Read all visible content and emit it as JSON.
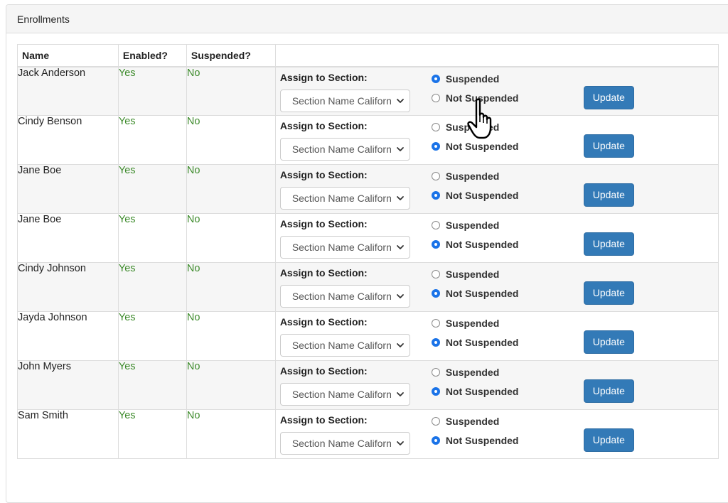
{
  "panel": {
    "title": "Enrollments"
  },
  "table": {
    "headers": {
      "name": "Name",
      "enabled": "Enabled?",
      "suspended": "Suspended?",
      "actions": ""
    },
    "rows": [
      {
        "name": "Jack Anderson",
        "enabled": "Yes",
        "suspended": "No",
        "assign_label": "Assign to Section:",
        "section_value": "Section Name Californ",
        "opt_suspended": "Suspended",
        "opt_not_suspended": "Not Suspended",
        "selected": "suspended",
        "button": "Update"
      },
      {
        "name": "Cindy Benson",
        "enabled": "Yes",
        "suspended": "No",
        "assign_label": "Assign to Section:",
        "section_value": "Section Name Californ",
        "opt_suspended": "Suspended",
        "opt_not_suspended": "Not Suspended",
        "selected": "not_suspended",
        "button": "Update"
      },
      {
        "name": "Jane Boe",
        "enabled": "Yes",
        "suspended": "No",
        "assign_label": "Assign to Section:",
        "section_value": "Section Name Californ",
        "opt_suspended": "Suspended",
        "opt_not_suspended": "Not Suspended",
        "selected": "not_suspended",
        "button": "Update"
      },
      {
        "name": "Jane Boe",
        "enabled": "Yes",
        "suspended": "No",
        "assign_label": "Assign to Section:",
        "section_value": "Section Name Californ",
        "opt_suspended": "Suspended",
        "opt_not_suspended": "Not Suspended",
        "selected": "not_suspended",
        "button": "Update"
      },
      {
        "name": "Cindy Johnson",
        "enabled": "Yes",
        "suspended": "No",
        "assign_label": "Assign to Section:",
        "section_value": "Section Name Californ",
        "opt_suspended": "Suspended",
        "opt_not_suspended": "Not Suspended",
        "selected": "not_suspended",
        "button": "Update"
      },
      {
        "name": "Jayda Johnson",
        "enabled": "Yes",
        "suspended": "No",
        "assign_label": "Assign to Section:",
        "section_value": "Section Name Californ",
        "opt_suspended": "Suspended",
        "opt_not_suspended": "Not Suspended",
        "selected": "not_suspended",
        "button": "Update"
      },
      {
        "name": "John Myers",
        "enabled": "Yes",
        "suspended": "No",
        "assign_label": "Assign to Section:",
        "section_value": "Section Name Californ",
        "opt_suspended": "Suspended",
        "opt_not_suspended": "Not Suspended",
        "selected": "not_suspended",
        "button": "Update"
      },
      {
        "name": "Sam Smith",
        "enabled": "Yes",
        "suspended": "No",
        "assign_label": "Assign to Section:",
        "section_value": "Section Name Californ",
        "opt_suspended": "Suspended",
        "opt_not_suspended": "Not Suspended",
        "selected": "not_suspended",
        "button": "Update"
      }
    ]
  },
  "colors": {
    "accent_button": "#337ab7",
    "status_green": "#3c8a2a",
    "radio_checked": "#1a73e8"
  },
  "icons": {
    "select_arrow": "chevron-down-icon",
    "pointer": "hand-pointer-icon"
  }
}
